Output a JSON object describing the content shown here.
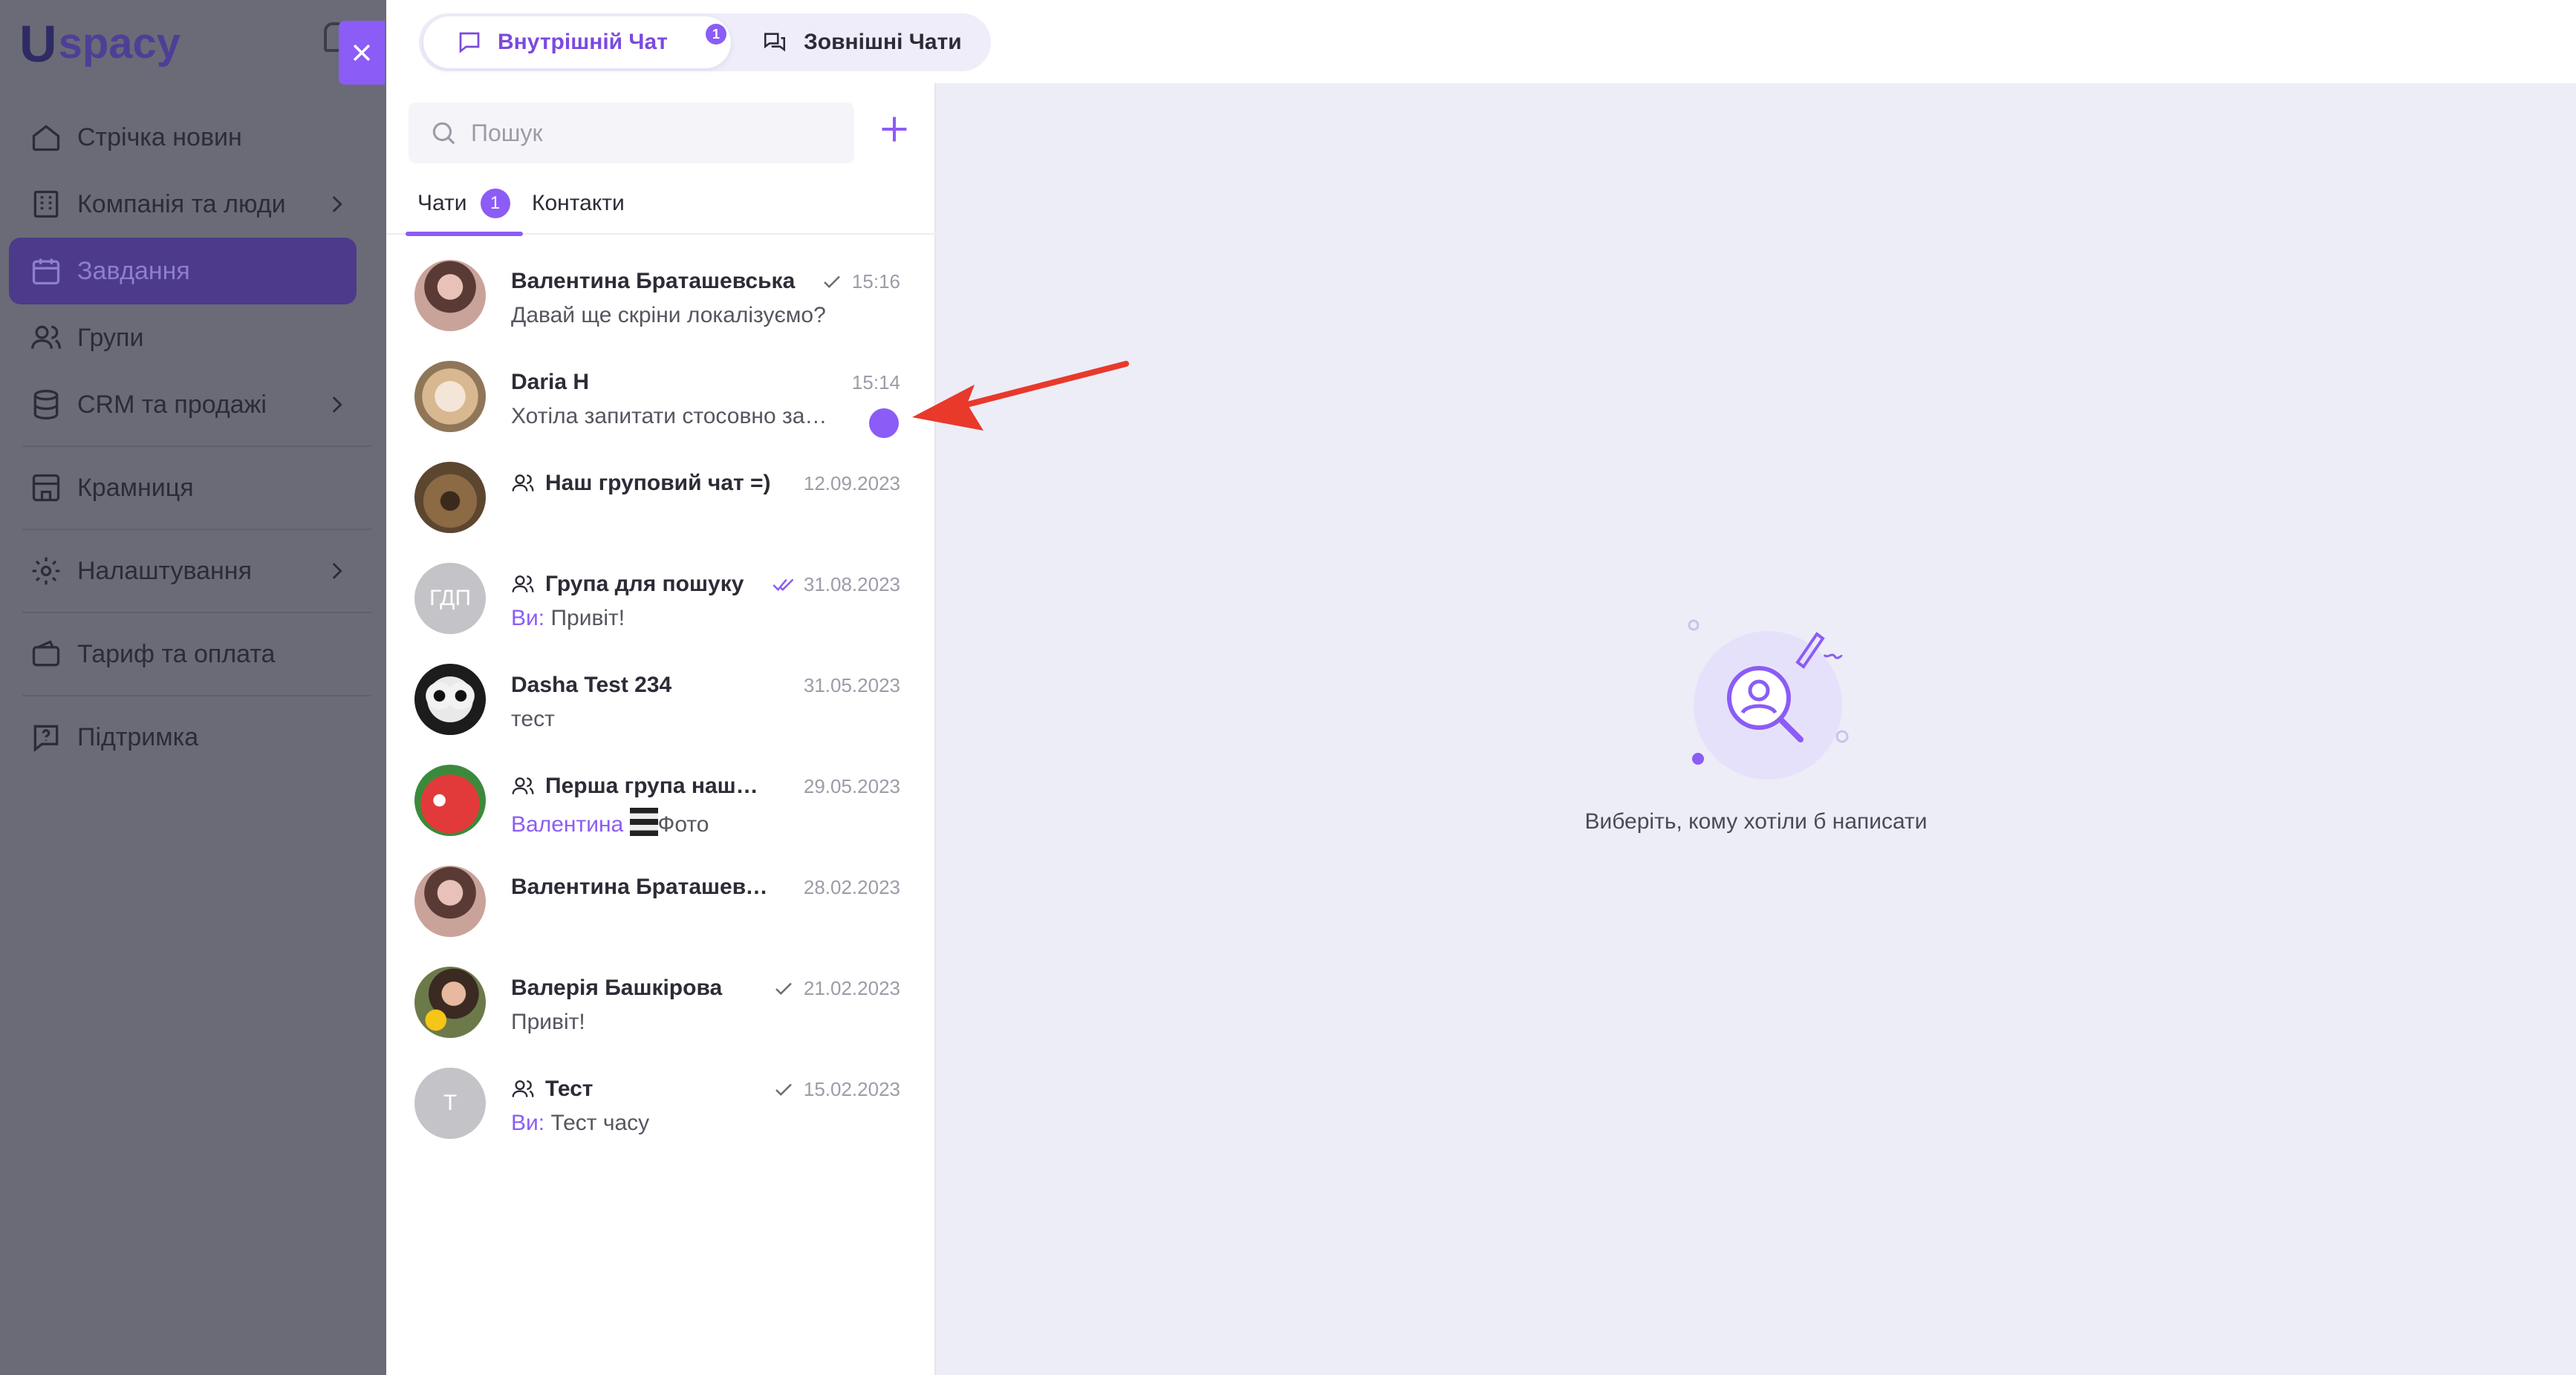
{
  "app": {
    "logo_u": "U",
    "logo_text": "spacy"
  },
  "sidebar": {
    "items": [
      {
        "label": "Стрічка новин",
        "icon": "home-icon"
      },
      {
        "label": "Компанія та люди",
        "icon": "building-icon",
        "has_arrow": true
      },
      {
        "label": "Завдання",
        "icon": "calendar-icon",
        "active": true
      },
      {
        "label": "Групи",
        "icon": "users-icon"
      },
      {
        "label": "CRM та продажі",
        "icon": "database-icon",
        "has_arrow": true
      },
      {
        "label": "Крамниця",
        "icon": "store-icon"
      },
      {
        "label": "Налаштування",
        "icon": "gear-icon",
        "has_arrow": true
      },
      {
        "label": "Тариф та оплата",
        "icon": "wallet-icon"
      },
      {
        "label": "Підтримка",
        "icon": "help-icon"
      }
    ]
  },
  "top_tabs": {
    "internal_label": "Внутрішній Чат",
    "internal_badge": "1",
    "external_label": "Зовнішні Чати"
  },
  "search": {
    "placeholder": "Пошук"
  },
  "sub_tabs": {
    "chats_label": "Чати",
    "chats_badge": "1",
    "contacts_label": "Контакти"
  },
  "chats": [
    {
      "name": "Валентина Браташевська",
      "time": "15:16",
      "message": "Давай ще скріни локалізуємо?",
      "check": "single"
    },
    {
      "name": "Daria H",
      "time": "15:14",
      "message": "Хотіла запитати стосовно завдання",
      "unread": true
    },
    {
      "name": "Наш груповий чат =)",
      "time": "12.09.2023",
      "message": "",
      "group": true
    },
    {
      "name": "Група для пошуку",
      "time": "31.08.2023",
      "sender": "Ви:",
      "message": "Привіт!",
      "group": true,
      "check": "double",
      "initials": "ГДП"
    },
    {
      "name": "Dasha Test 234",
      "time": "31.05.2023",
      "message": "тест"
    },
    {
      "name": "Перша група нашого чату",
      "time": "29.05.2023",
      "sender": "Валентина",
      "message": "Фото",
      "group": true
    },
    {
      "name": "Валентина Браташевська",
      "time": "28.02.2023",
      "message": ""
    },
    {
      "name": "Валерія Башкірова",
      "time": "21.02.2023",
      "message": "Привіт!",
      "check": "single"
    },
    {
      "name": "Тест",
      "time": "15.02.2023",
      "sender": "Ви:",
      "message": "Тест часу",
      "group": true,
      "check": "single",
      "initials": "Т"
    }
  ],
  "empty_state": {
    "text": "Виберіть, кому хотіли б написати"
  },
  "colors": {
    "accent": "#8b5cf6",
    "annotation": "#e8392b"
  }
}
